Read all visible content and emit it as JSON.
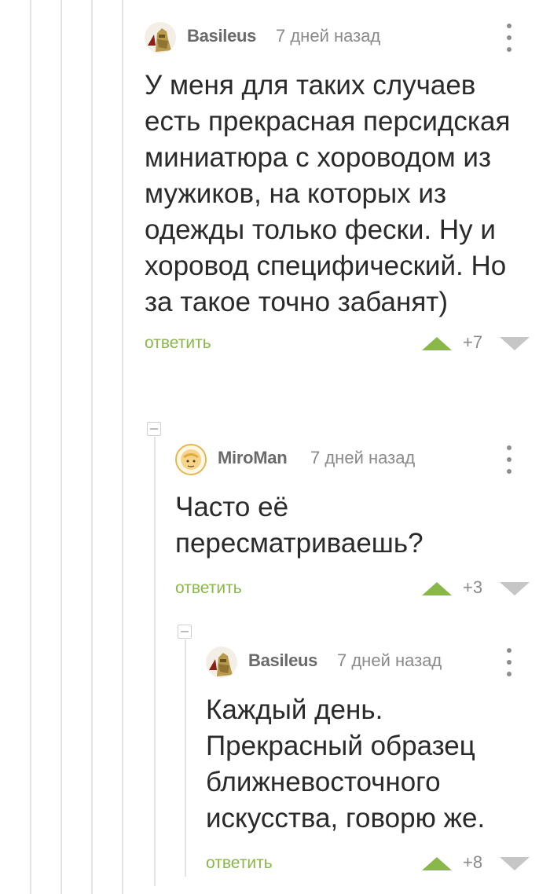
{
  "comments": [
    {
      "username": "Basileus",
      "time": "7 дней назад",
      "text": "У меня для таких случаев есть прекрасная персидская миниатюра с хороводом из мужиков, на которых из одежды только фески. Ну и хоровод специфический. Но за такое точно забанят)",
      "reply_label": "ответить",
      "rating": "+7"
    },
    {
      "username": "MiroMan",
      "time": "7 дней назад",
      "text": "Часто её пересматриваешь?",
      "reply_label": "ответить",
      "rating": "+3"
    },
    {
      "username": "Basileus",
      "time": "7 дней назад",
      "text": "Каждый день. Прекрасный образец ближневосточного искусства, говорю же.",
      "reply_label": "ответить",
      "rating": "+8"
    }
  ],
  "icons": {
    "collapse": "minus-square-icon",
    "more": "vertical-dots-icon",
    "upvote": "triangle-up-icon",
    "downvote": "triangle-down-icon"
  },
  "colors": {
    "reply": "#8ab74a",
    "upvote": "#8ab74a",
    "downvote": "#c6c6c6",
    "thread_line": "#e4e4e4"
  }
}
